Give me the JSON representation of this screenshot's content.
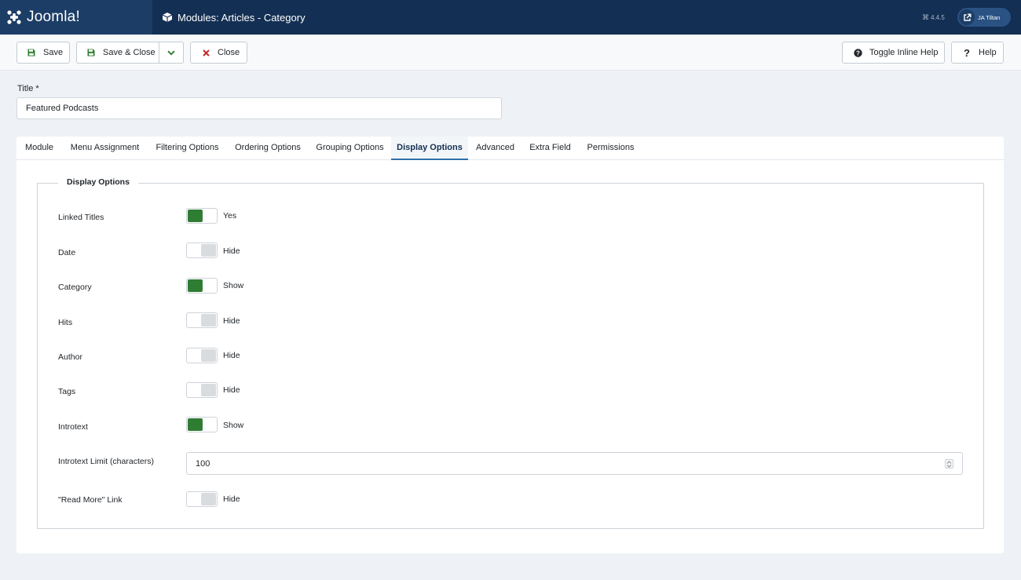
{
  "header": {
    "brand": "Joomla!",
    "page_title": "Modules: Articles - Category",
    "version": "4.4.5",
    "site_label": "JA Tiltan"
  },
  "toolbar": {
    "save_label": "Save",
    "save_close_label": "Save & Close",
    "close_label": "Close",
    "toggle_inline_help_label": "Toggle Inline Help",
    "help_label": "Help"
  },
  "title_field": {
    "label": "Title *",
    "value": "Featured Podcasts"
  },
  "tabs": [
    {
      "label": "Module"
    },
    {
      "label": "Menu Assignment"
    },
    {
      "label": "Filtering Options"
    },
    {
      "label": "Ordering Options"
    },
    {
      "label": "Grouping Options"
    },
    {
      "label": "Display Options",
      "active": true
    },
    {
      "label": "Advanced"
    },
    {
      "label": "Extra Field"
    },
    {
      "label": "Permissions"
    }
  ],
  "display_options": {
    "legend": "Display Options",
    "fields": [
      {
        "label": "Linked Titles",
        "on": true,
        "state": "Yes"
      },
      {
        "label": "Date",
        "on": false,
        "state": "Hide"
      },
      {
        "label": "Category",
        "on": true,
        "state": "Show"
      },
      {
        "label": "Hits",
        "on": false,
        "state": "Hide"
      },
      {
        "label": "Author",
        "on": false,
        "state": "Hide"
      },
      {
        "label": "Tags",
        "on": false,
        "state": "Hide"
      },
      {
        "label": "Introtext",
        "on": true,
        "state": "Show"
      },
      {
        "label": "Introtext Limit (characters)",
        "value": "100"
      },
      {
        "label": "\"Read More\" Link",
        "on": false,
        "state": "Hide"
      }
    ]
  },
  "colors": {
    "header_bg": "#132f53",
    "switch_on": "#2f7d32",
    "active_tab_underline": "#3071a9",
    "close_icon": "#c62828"
  }
}
